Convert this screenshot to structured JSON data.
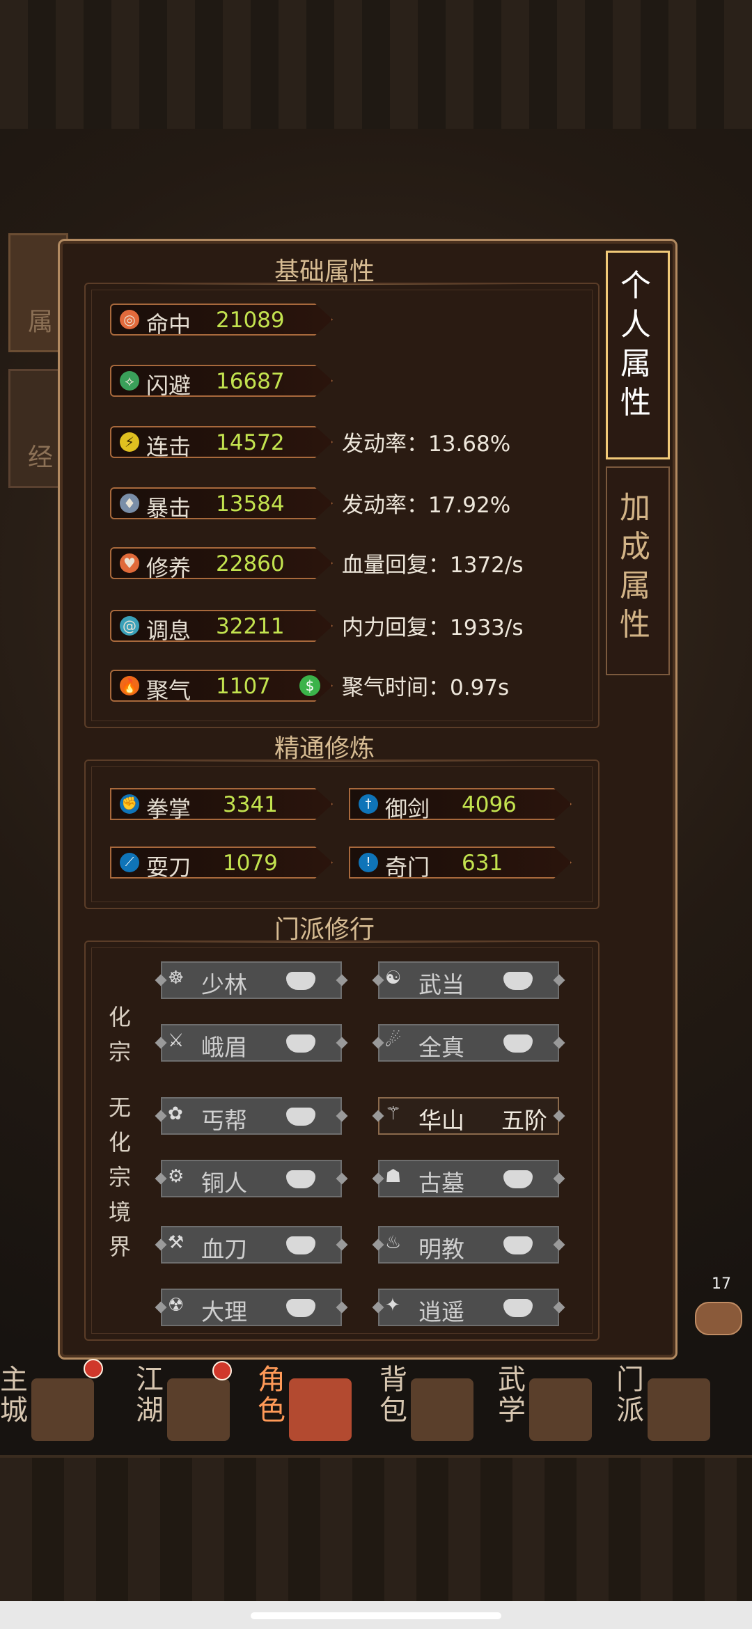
{
  "tabs": {
    "active": "个人属性",
    "inactive": "加成属性"
  },
  "sections": {
    "basic": "基础属性",
    "mastery": "精通修炼",
    "school": "门派修行"
  },
  "basic_stats": [
    {
      "name": "命中",
      "value": "21089",
      "extra": ""
    },
    {
      "name": "闪避",
      "value": "16687",
      "extra": ""
    },
    {
      "name": "连击",
      "value": "14572",
      "extra": "发动率：13.68%"
    },
    {
      "name": "暴击",
      "value": "13584",
      "extra": "发动率：17.92%"
    },
    {
      "name": "修养",
      "value": "22860",
      "extra": "血量回复：1372/s"
    },
    {
      "name": "调息",
      "value": "32211",
      "extra": "内力回复：1933/s"
    },
    {
      "name": "聚气",
      "value": "1107",
      "extra": "聚气时间：0.97s"
    }
  ],
  "mastery": [
    {
      "name": "拳掌",
      "value": "3341"
    },
    {
      "name": "御剑",
      "value": "4096"
    },
    {
      "name": "耍刀",
      "value": "1079"
    },
    {
      "name": "奇门",
      "value": "631"
    }
  ],
  "school_labels": {
    "top": "化宗",
    "bottom": "无化宗境界"
  },
  "schools": [
    {
      "name": "少林",
      "tier": ""
    },
    {
      "name": "武当",
      "tier": ""
    },
    {
      "name": "峨眉",
      "tier": ""
    },
    {
      "name": "全真",
      "tier": ""
    },
    {
      "name": "丐帮",
      "tier": ""
    },
    {
      "name": "华山",
      "tier": "五阶"
    },
    {
      "name": "铜人",
      "tier": ""
    },
    {
      "name": "古墓",
      "tier": ""
    },
    {
      "name": "血刀",
      "tier": ""
    },
    {
      "name": "明教",
      "tier": ""
    },
    {
      "name": "大理",
      "tier": ""
    },
    {
      "name": "逍遥",
      "tier": ""
    }
  ],
  "chat": {
    "count": "17"
  },
  "bottom_nav": [
    {
      "label": "主城"
    },
    {
      "label": "江湖"
    },
    {
      "label": "角色"
    },
    {
      "label": "背包"
    },
    {
      "label": "武学"
    },
    {
      "label": "门派"
    }
  ],
  "colors": {
    "stat_value": "#c3e34f",
    "active_tab_border": "#f1c978",
    "panel_border": "#b28a61"
  }
}
